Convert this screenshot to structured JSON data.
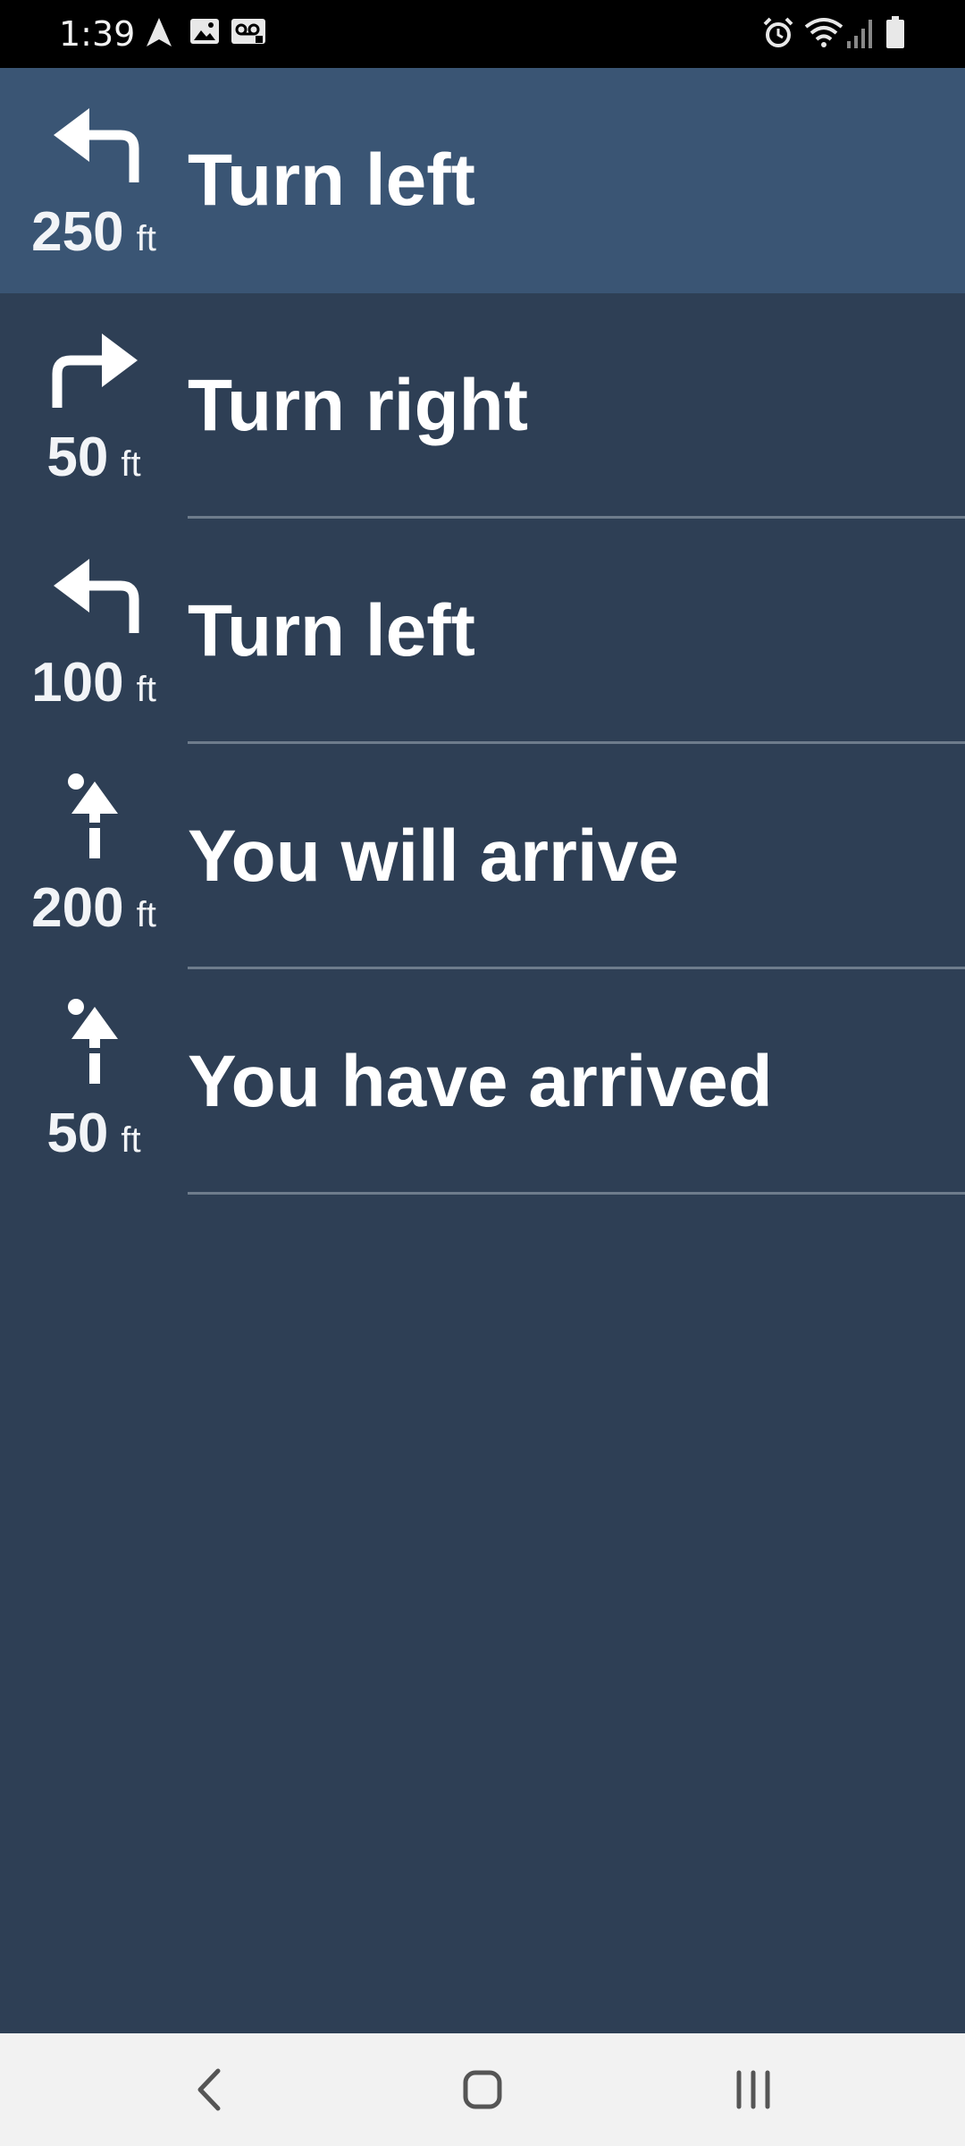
{
  "status_bar": {
    "time": "1:39",
    "left_icons": [
      "navigation-arrow-icon",
      "image-icon",
      "voicemail-icon"
    ],
    "right_icons": [
      "alarm-icon",
      "wifi-icon",
      "signal-icon",
      "battery-icon"
    ]
  },
  "steps": [
    {
      "instruction": "Turn left",
      "distance": "250",
      "unit": "ft",
      "icon": "turn-left-icon",
      "active": true
    },
    {
      "instruction": "Turn right",
      "distance": "50",
      "unit": "ft",
      "icon": "turn-right-icon",
      "active": false
    },
    {
      "instruction": "Turn left",
      "distance": "100",
      "unit": "ft",
      "icon": "turn-left-icon",
      "active": false
    },
    {
      "instruction": "You will arrive",
      "distance": "200",
      "unit": "ft",
      "icon": "arrive-icon",
      "active": false
    },
    {
      "instruction": "You have arrived",
      "distance": "50",
      "unit": "ft",
      "icon": "arrive-icon",
      "active": false
    }
  ],
  "nav_bar": {
    "buttons": [
      "back-icon",
      "home-icon",
      "recents-icon"
    ]
  },
  "colors": {
    "background": "#2e3f55",
    "active_row": "#3a5574",
    "divider": "#6e7c8c",
    "nav_bar": "#f2f2f2"
  }
}
